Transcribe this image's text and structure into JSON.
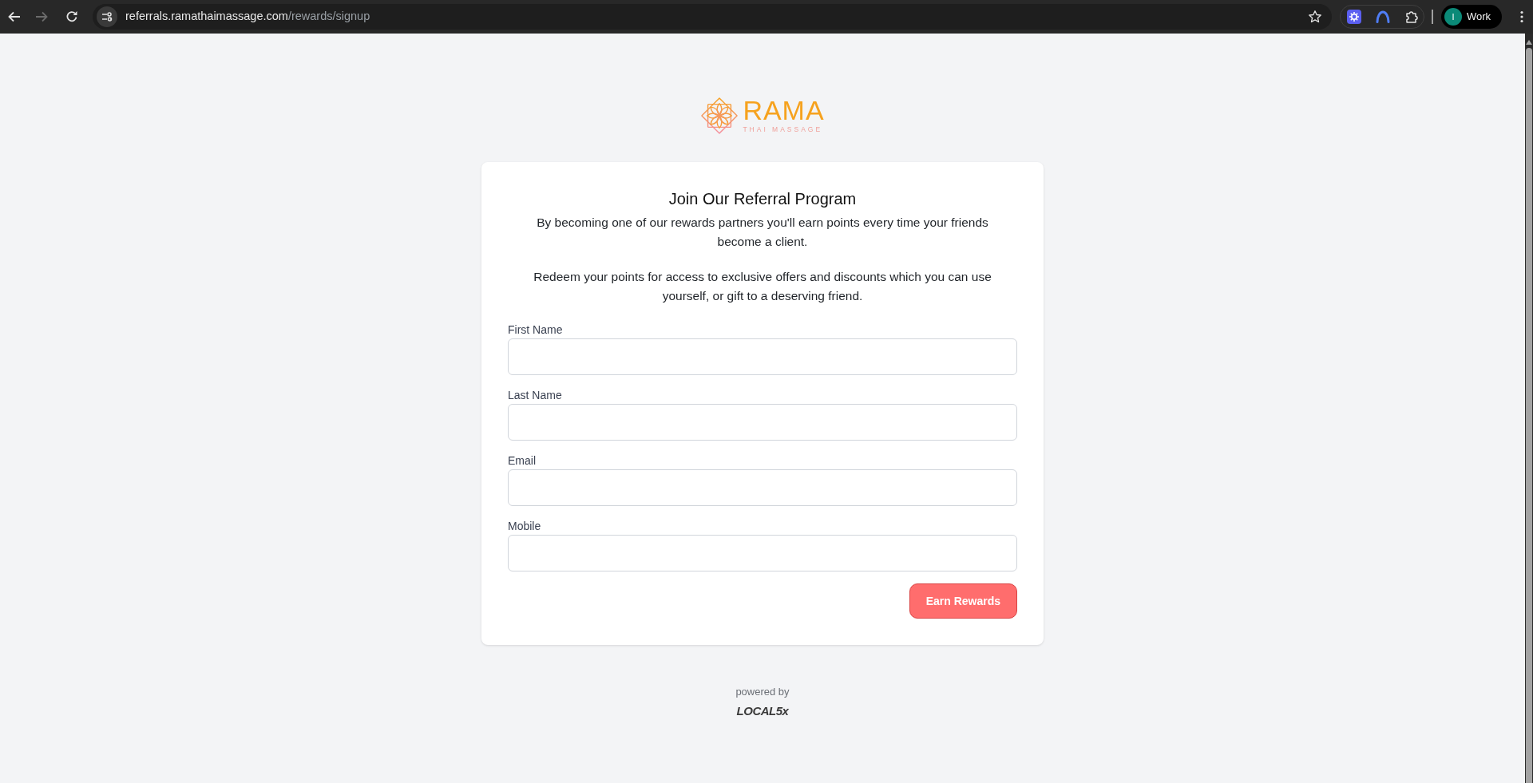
{
  "browser": {
    "url_host": "referrals.ramathaimassage.com",
    "url_path": "/rewards/signup",
    "forward_disabled": true,
    "profile": {
      "initial": "I",
      "label": "Work"
    }
  },
  "logo": {
    "name": "RAMA",
    "tagline": "THAI MASSAGE"
  },
  "form": {
    "title": "Join Our Referral Program",
    "paragraphs": [
      "By becoming one of our rewards partners you'll earn points every time your friends become a client.",
      "Redeem your points for access to exclusive offers and discounts which you can use yourself, or gift to a deserving friend."
    ],
    "fields": [
      {
        "label": "First Name"
      },
      {
        "label": "Last Name"
      },
      {
        "label": "Email"
      },
      {
        "label": "Mobile"
      }
    ],
    "submit": "Earn Rewards"
  },
  "footer": {
    "powered_by": "powered by",
    "brand": "LOCAL5x"
  }
}
